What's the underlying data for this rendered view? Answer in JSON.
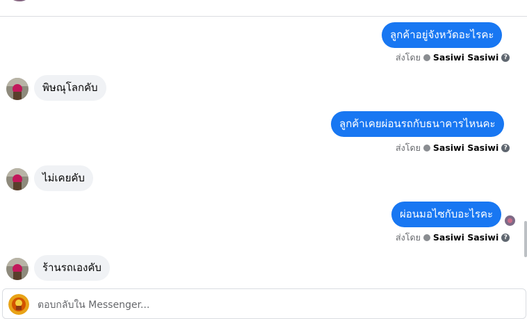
{
  "messages": [
    {
      "direction": "out",
      "text": "ลูกค้าอยู่จังหวัดอะไรคะ",
      "sent_by_label": "ส่งโดย",
      "sender": "Sasiwi Sasiwi"
    },
    {
      "direction": "in",
      "text": "พิษณุโลกคับ"
    },
    {
      "direction": "out",
      "text": "ลูกค้าเคยผ่อนรถกับธนาคารไหนคะ",
      "sent_by_label": "ส่งโดย",
      "sender": "Sasiwi Sasiwi"
    },
    {
      "direction": "in",
      "text": "ไม่เคยคับ"
    },
    {
      "direction": "out",
      "text": "ผ่อนมอไซกับอะไรคะ",
      "sent_by_label": "ส่งโดย",
      "sender": "Sasiwi Sasiwi"
    },
    {
      "direction": "in",
      "text": "ร้านรถเองคับ"
    }
  ],
  "composer": {
    "placeholder": "ตอบกลับใน Messenger..."
  },
  "icons": {
    "verified": "verified-icon",
    "help": "help-icon",
    "avatar": "customer-avatar",
    "seen": "seen-avatar"
  },
  "colors": {
    "outgoing_bubble": "#1877f2",
    "incoming_bubble": "#f0f2f5",
    "meta_text": "#65676b"
  }
}
